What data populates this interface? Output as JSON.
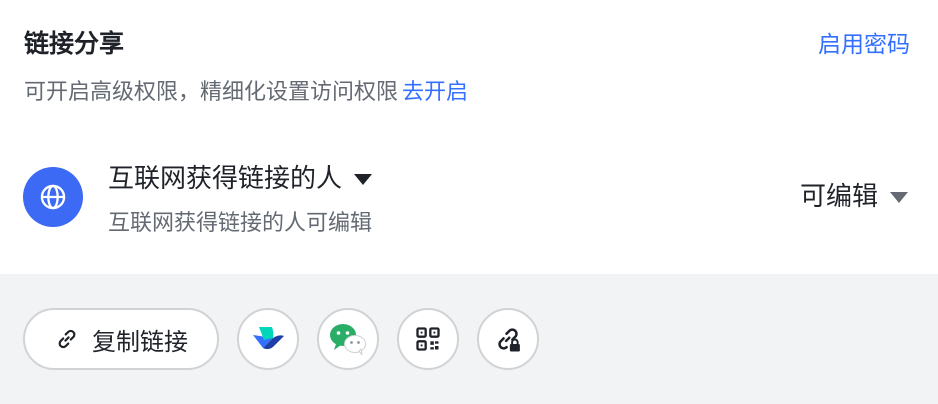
{
  "header": {
    "title": "链接分享",
    "password_link": "启用密码"
  },
  "notice": {
    "text": "可开启高级权限，精细化设置访问权限",
    "action": "去开启"
  },
  "share_scope": {
    "label": "互联网获得链接的人",
    "description": "互联网获得链接的人可编辑",
    "icon": "globe-icon"
  },
  "permission": {
    "selected": "可编辑"
  },
  "share_actions": {
    "copy_label": "复制链接",
    "buttons": [
      "lark-icon",
      "wechat-icon",
      "qrcode-icon",
      "link-lock-icon"
    ]
  },
  "colors": {
    "accent": "#3370ff",
    "globe_bg": "#3d6af5",
    "footer_bg": "#f2f3f5"
  }
}
